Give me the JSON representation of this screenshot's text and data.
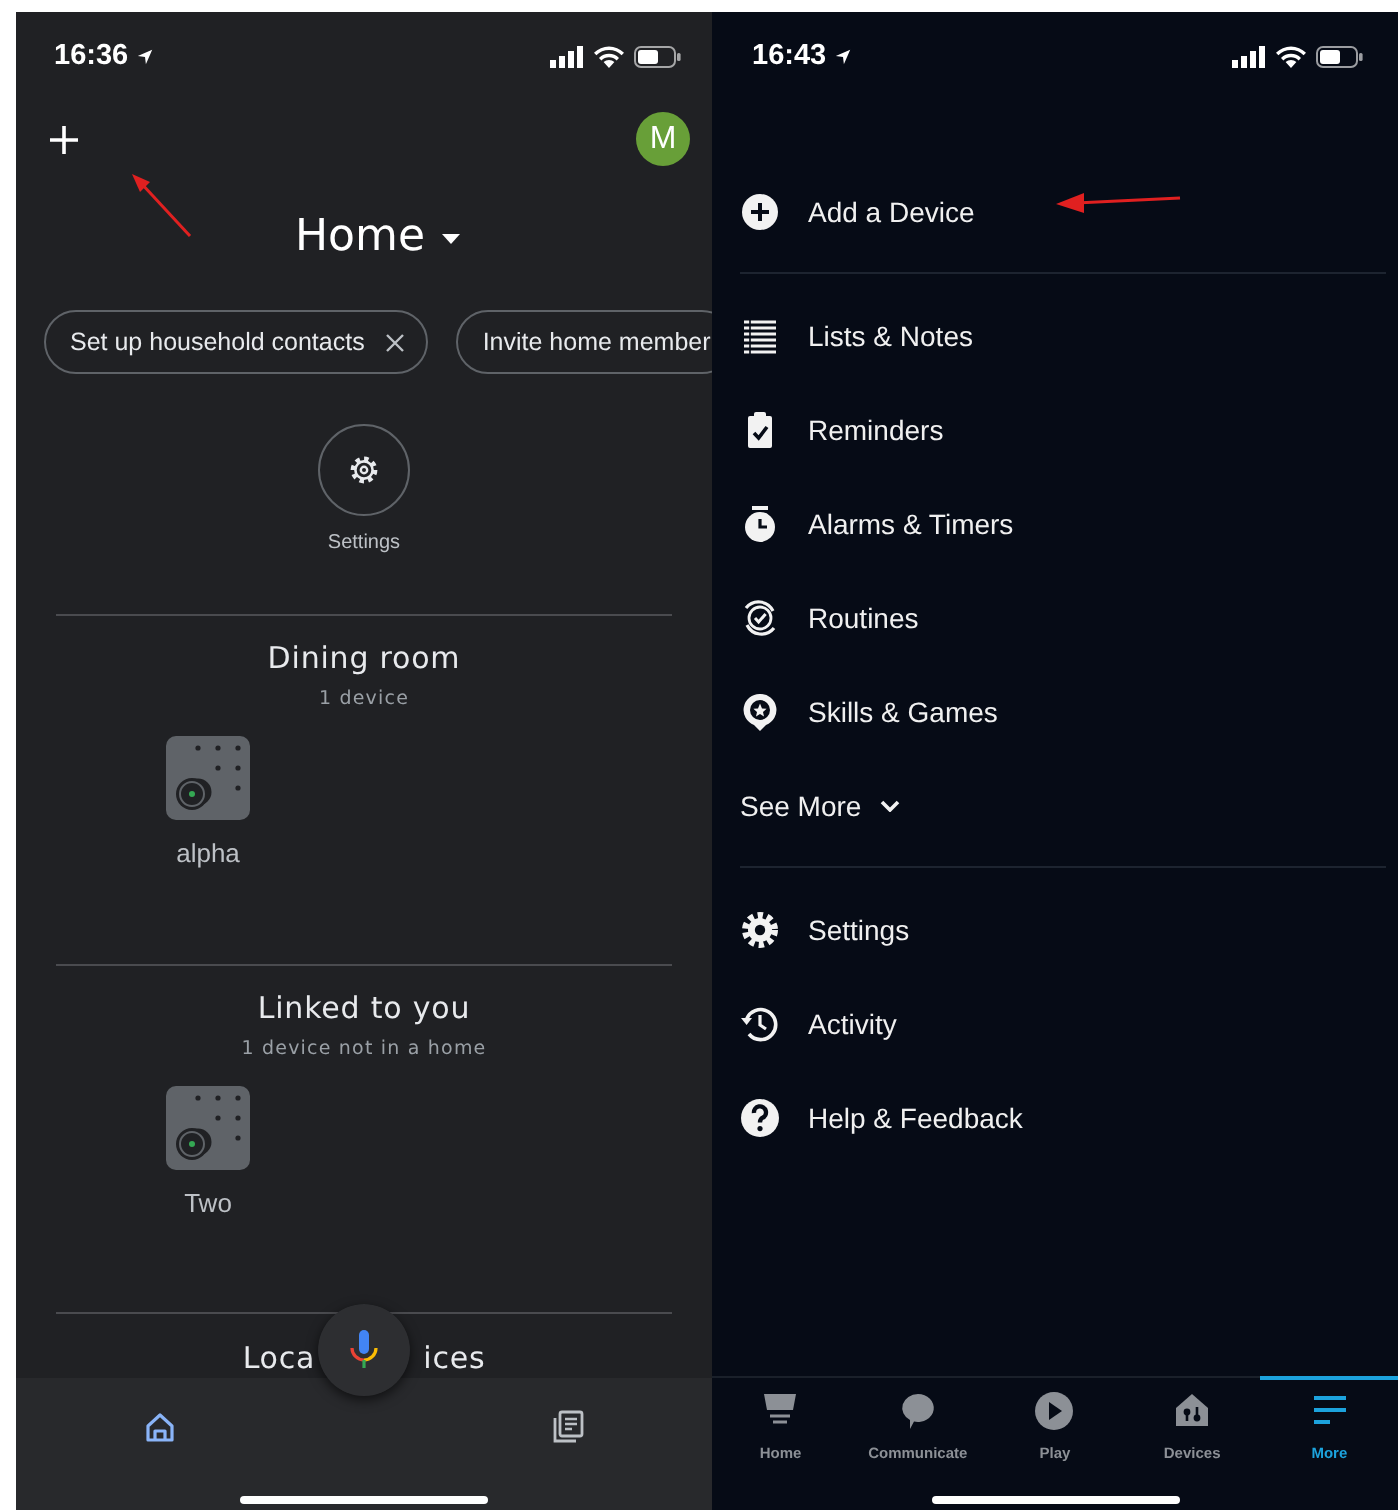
{
  "left_screen": {
    "status_bar": {
      "time": "16:36"
    },
    "avatar": {
      "initial": "M"
    },
    "title": "Home",
    "chips": [
      {
        "label": "Set up household contacts",
        "dismissible": true
      },
      {
        "label": "Invite home member",
        "dismissible": false
      }
    ],
    "settings_label": "Settings",
    "sections": [
      {
        "title": "Dining room",
        "subtitle": "1 device",
        "devices": [
          {
            "name": "alpha"
          }
        ]
      },
      {
        "title": "Linked to you",
        "subtitle": "1 device not in a home",
        "devices": [
          {
            "name": "Two"
          }
        ]
      }
    ],
    "partial_section": {
      "title_start": "Loca",
      "title_end": "ices"
    },
    "bottom_nav": [
      {
        "kind": "home",
        "selected": true
      },
      {
        "kind": "feed",
        "selected": false
      }
    ]
  },
  "right_screen": {
    "status_bar": {
      "time": "16:43"
    },
    "menu_sections": [
      {
        "items": [
          {
            "kind": "add",
            "label": "Add a Device"
          }
        ]
      },
      {
        "items": [
          {
            "kind": "list",
            "label": "Lists & Notes"
          },
          {
            "kind": "reminder",
            "label": "Reminders"
          },
          {
            "kind": "alarm",
            "label": "Alarms & Timers"
          },
          {
            "kind": "routine",
            "label": "Routines"
          },
          {
            "kind": "skills",
            "label": "Skills & Games"
          },
          {
            "kind": "expander",
            "label": "See More"
          }
        ]
      },
      {
        "items": [
          {
            "kind": "settings",
            "label": "Settings"
          },
          {
            "kind": "activity",
            "label": "Activity"
          },
          {
            "kind": "help",
            "label": "Help & Feedback"
          }
        ]
      }
    ],
    "bottom_tabs": [
      {
        "kind": "home",
        "label": "Home",
        "selected": false
      },
      {
        "kind": "communicate",
        "label": "Communicate",
        "selected": false
      },
      {
        "kind": "play",
        "label": "Play",
        "selected": false
      },
      {
        "kind": "devices",
        "label": "Devices",
        "selected": false
      },
      {
        "kind": "more",
        "label": "More",
        "selected": true
      }
    ]
  }
}
